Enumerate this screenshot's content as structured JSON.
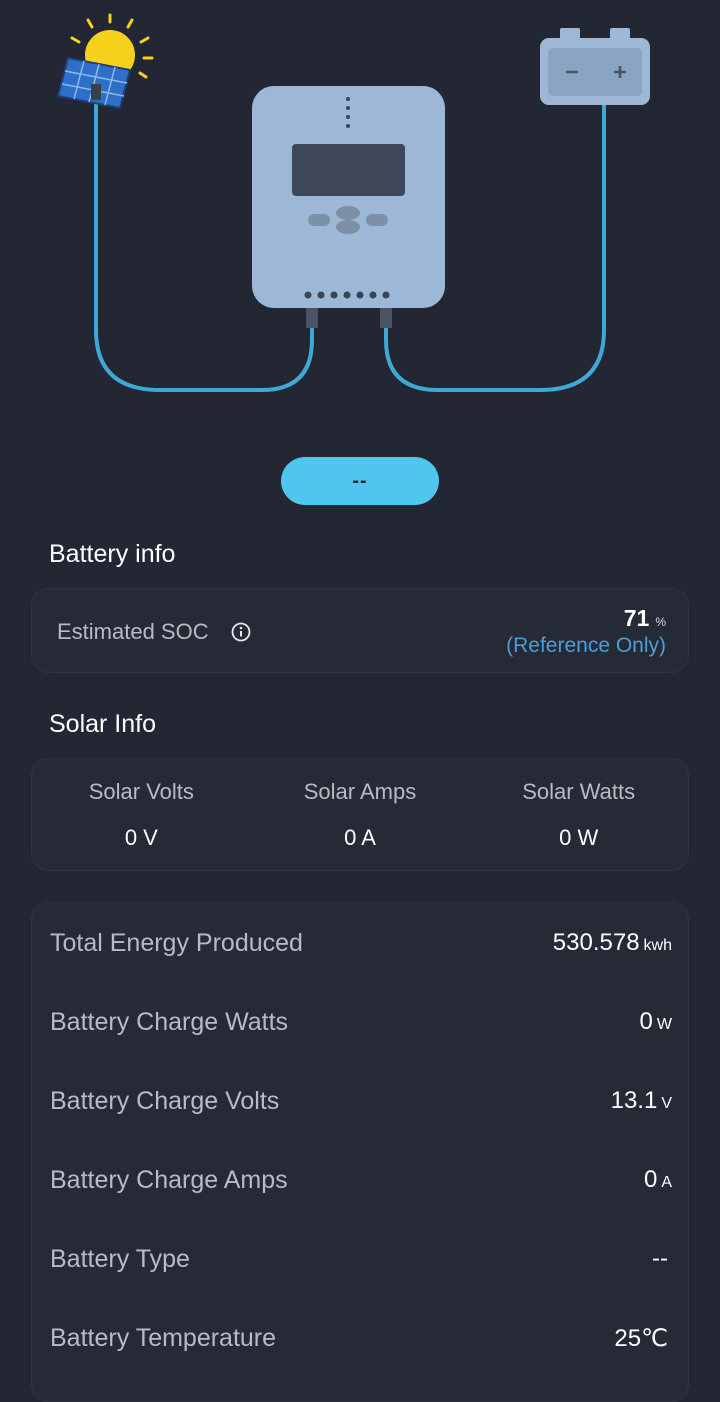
{
  "status_pill": "--",
  "battery_info": {
    "title": "Battery info",
    "soc_label": "Estimated SOC",
    "soc_value": "71",
    "soc_unit": "%",
    "soc_note": "(Reference Only)"
  },
  "solar_info": {
    "title": "Solar Info",
    "columns": [
      {
        "label": "Solar Volts",
        "value": "0 V"
      },
      {
        "label": "Solar Amps",
        "value": "0 A"
      },
      {
        "label": "Solar Watts",
        "value": "0 W"
      }
    ]
  },
  "metrics": [
    {
      "label": "Total Energy Produced",
      "value": "530.578",
      "unit": "kwh"
    },
    {
      "label": "Battery Charge Watts",
      "value": "0",
      "unit": "W"
    },
    {
      "label": "Battery Charge Volts",
      "value": "13.1",
      "unit": "V"
    },
    {
      "label": "Battery Charge Amps",
      "value": "0",
      "unit": "A"
    },
    {
      "label": "Battery Type",
      "value": "--",
      "unit": ""
    },
    {
      "label": "Battery Temperature",
      "value": "25℃",
      "unit": ""
    }
  ],
  "icons": {
    "sun": "sun-icon",
    "solar_panel": "solar-panel-icon",
    "controller": "charge-controller-icon",
    "battery": "battery-icon",
    "info": "info-icon"
  },
  "colors": {
    "background": "#232733",
    "accent": "#4fc6ee",
    "cable": "#3fa9d6",
    "device": "#9db8d6",
    "reference_text": "#4a9fd6"
  }
}
